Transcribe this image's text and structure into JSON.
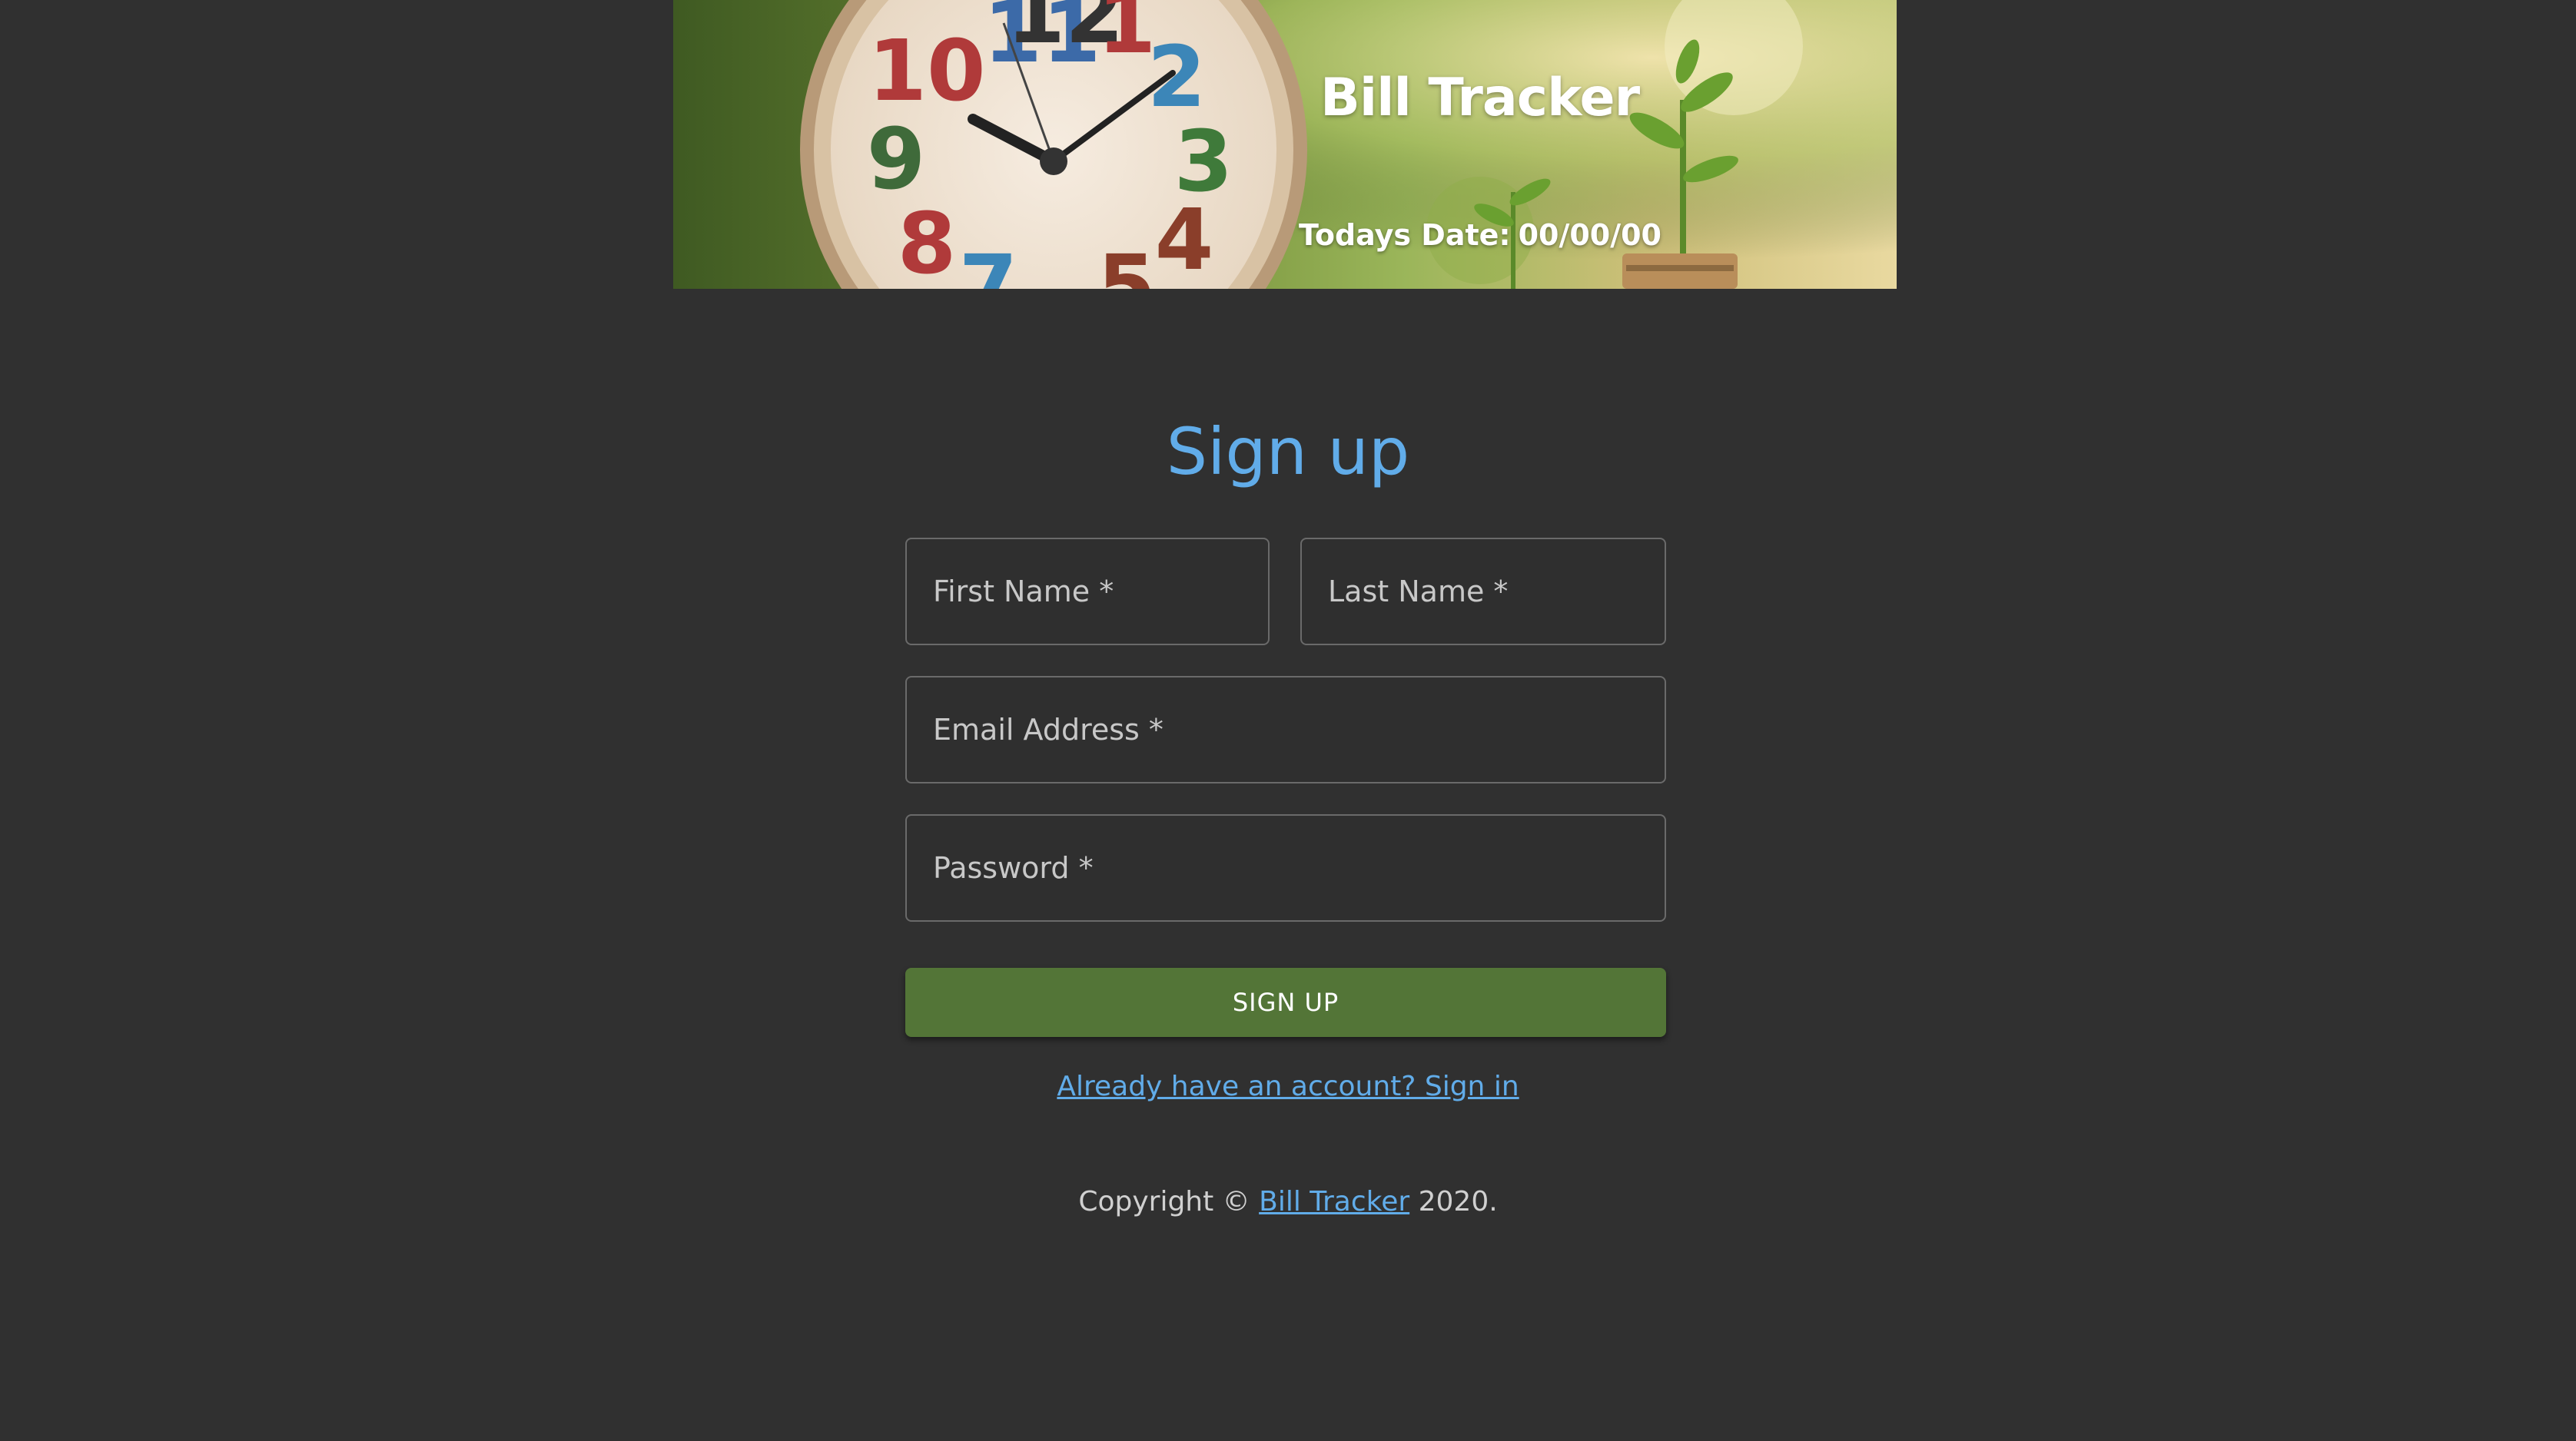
{
  "banner": {
    "title": "Bill Tracker",
    "date_label": "Todays Date:",
    "date_value": "00/00/00"
  },
  "form": {
    "heading": "Sign up",
    "first_name_placeholder": "First Name *",
    "last_name_placeholder": "Last Name *",
    "email_placeholder": "Email Address *",
    "password_placeholder": "Password *",
    "submit_label": "SIGN UP",
    "signin_link": "Already have an account? Sign in"
  },
  "footer": {
    "prefix": "Copyright ©",
    "link": "Bill Tracker",
    "suffix": "2020."
  },
  "colors": {
    "background": "#303030",
    "accent": "#61ace9",
    "button": "#537537"
  },
  "icons": {
    "banner_image": "clock-and-plants-photo"
  }
}
